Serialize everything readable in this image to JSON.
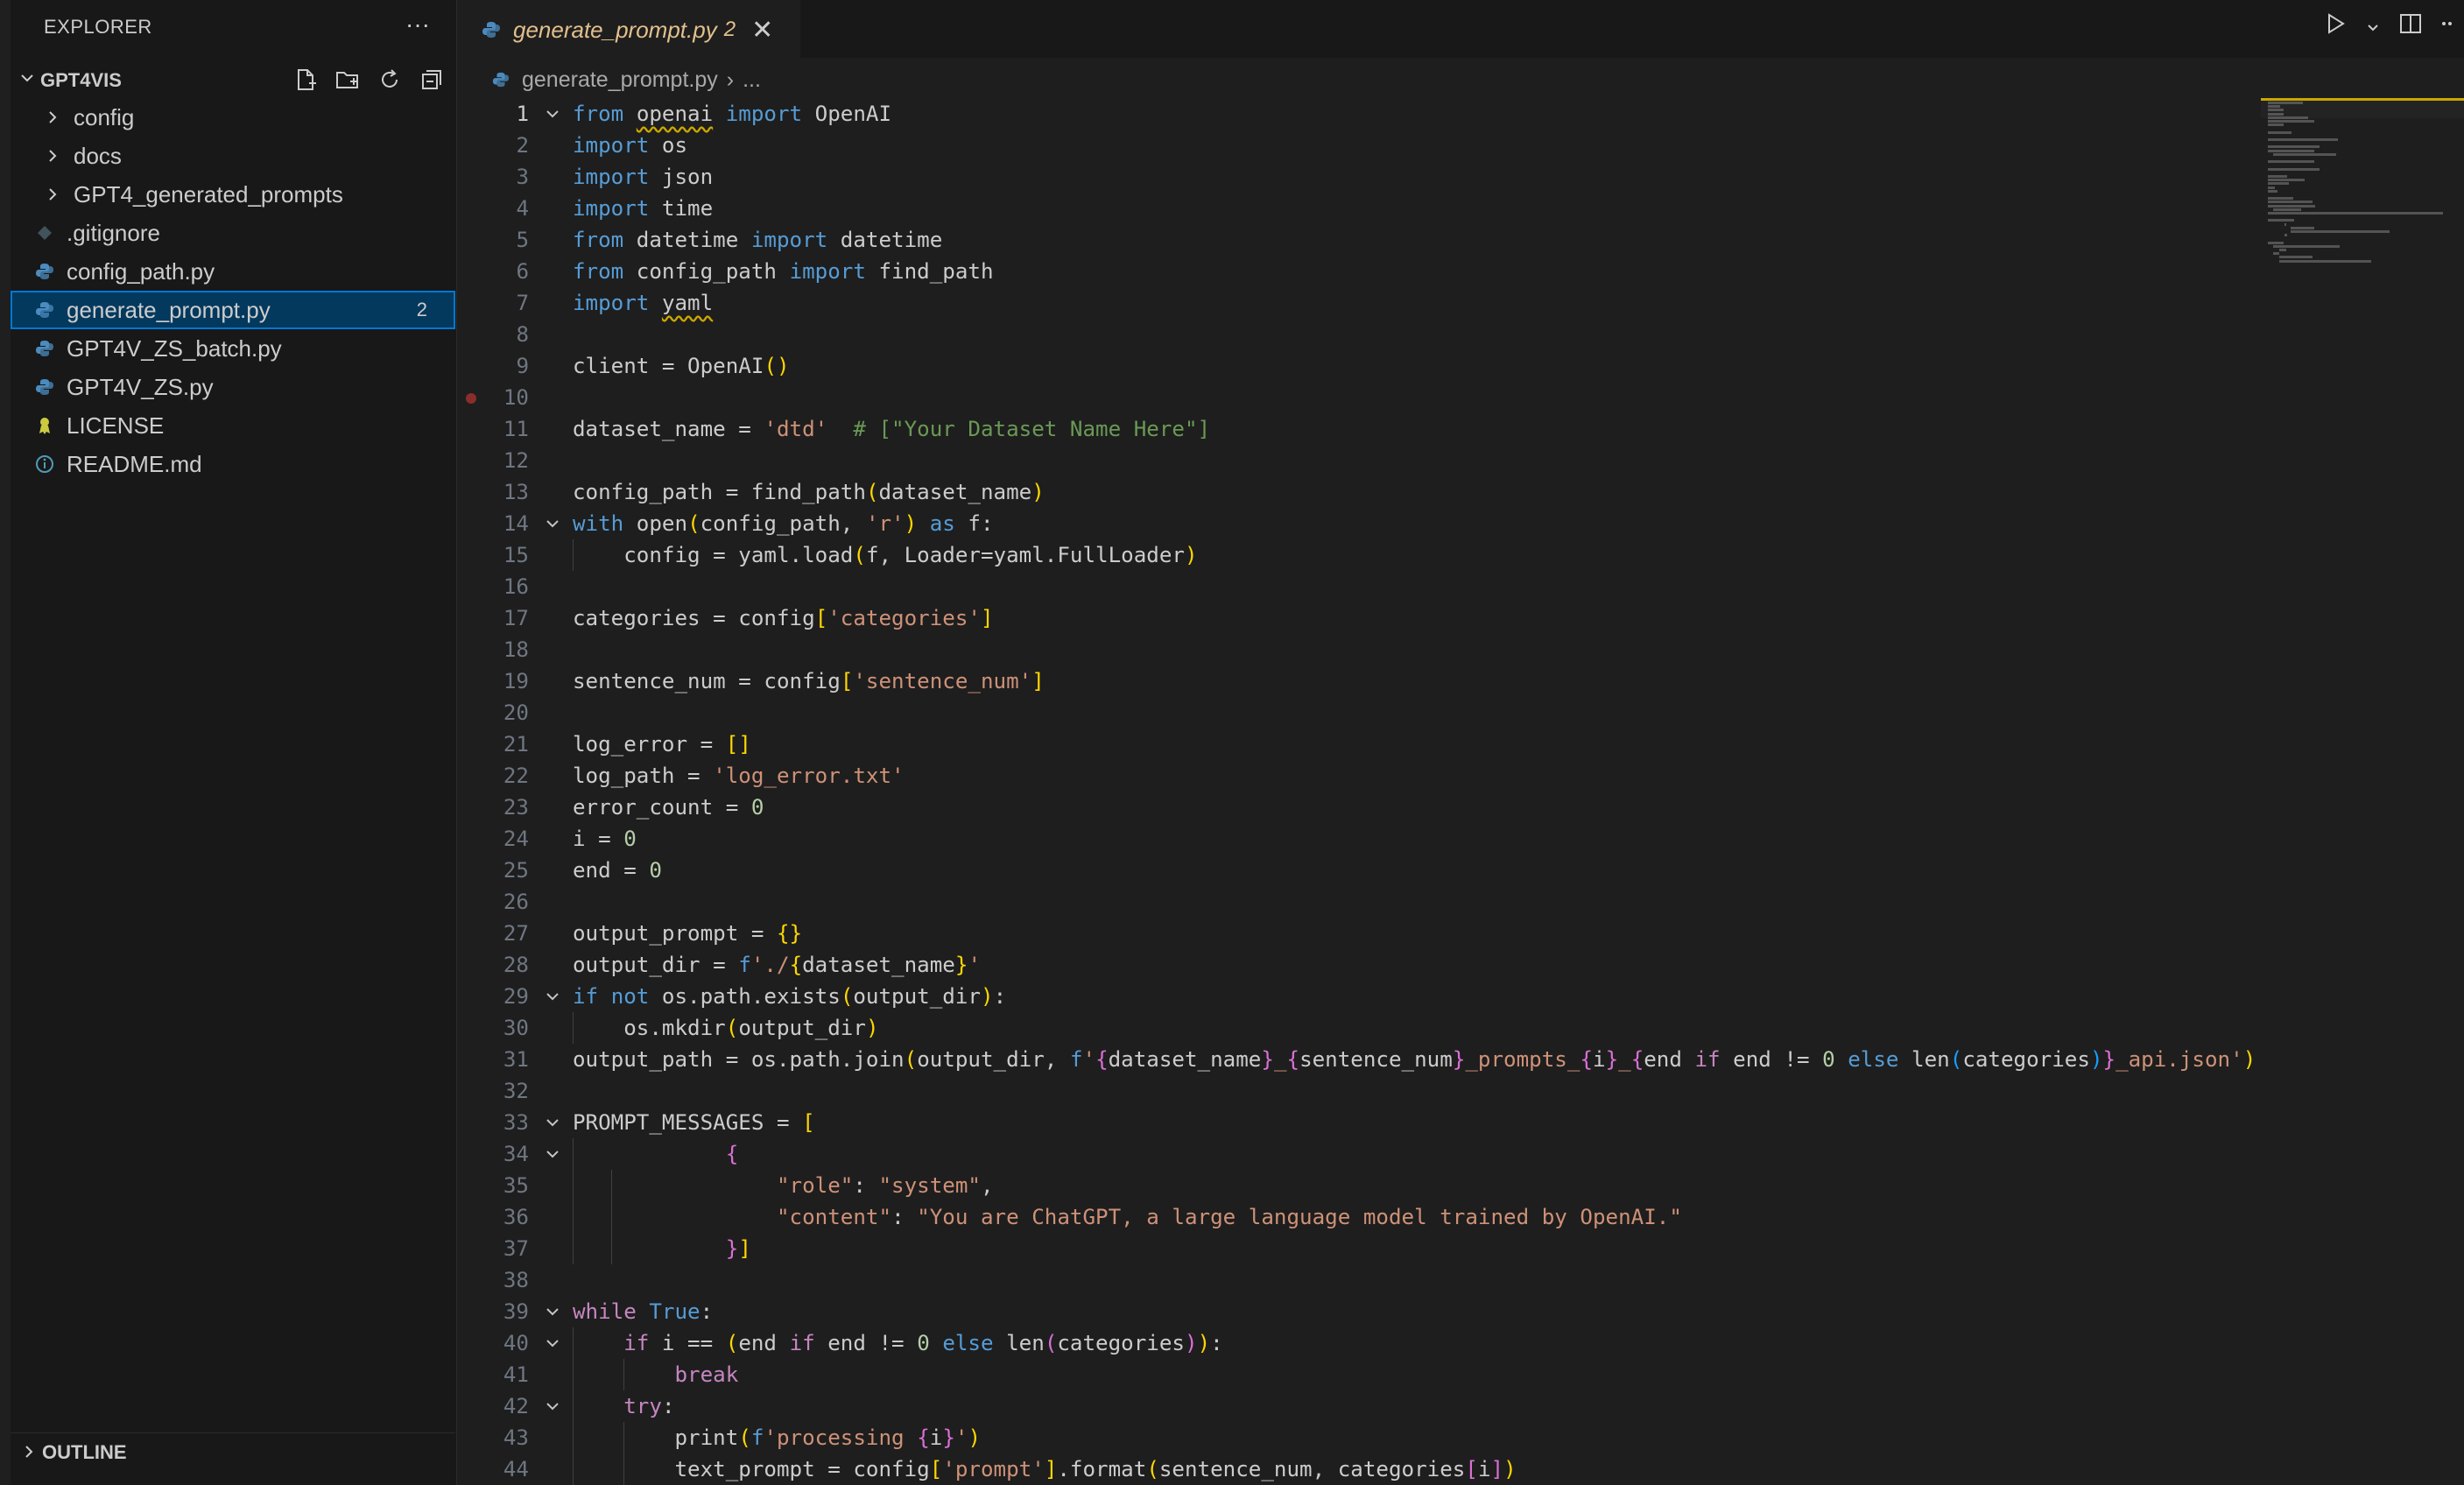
{
  "sidebar": {
    "title": "EXPLORER",
    "more": "···",
    "workspace": "GPT4VIS",
    "items": [
      {
        "label": "config",
        "type": "folder"
      },
      {
        "label": "docs",
        "type": "folder"
      },
      {
        "label": "GPT4_generated_prompts",
        "type": "folder"
      },
      {
        "label": ".gitignore",
        "type": "git"
      },
      {
        "label": "config_path.py",
        "type": "py"
      },
      {
        "label": "generate_prompt.py",
        "type": "py",
        "badge": "2",
        "selected": true
      },
      {
        "label": "GPT4V_ZS_batch.py",
        "type": "py"
      },
      {
        "label": "GPT4V_ZS.py",
        "type": "py"
      },
      {
        "label": "LICENSE",
        "type": "license"
      },
      {
        "label": "README.md",
        "type": "info"
      }
    ],
    "outline": "OUTLINE"
  },
  "tab": {
    "name": "generate_prompt.py",
    "problems": "2",
    "close": "✕"
  },
  "breadcrumb": {
    "file": "generate_prompt.py",
    "sep": "›",
    "rest": "..."
  },
  "editor": {
    "current_line": 1,
    "breakpoint_line": 10,
    "fold_lines": [
      1,
      14,
      29,
      33,
      34,
      39,
      40,
      42
    ]
  },
  "colors": {
    "accent": "#0078d4",
    "selection": "#04395e",
    "modified": "#e2c08d",
    "python": "#4b8bbe",
    "warning": "#cca700"
  },
  "code": [
    [
      [
        "kb",
        "from"
      ],
      [
        "",
        " "
      ],
      [
        "sq",
        "openai"
      ],
      [
        "",
        " "
      ],
      [
        "kb",
        "import"
      ],
      [
        "",
        " OpenAI"
      ]
    ],
    [
      [
        "kb",
        "import"
      ],
      [
        "",
        " os"
      ]
    ],
    [
      [
        "kb",
        "import"
      ],
      [
        "",
        " json"
      ]
    ],
    [
      [
        "kb",
        "import"
      ],
      [
        "",
        " time"
      ]
    ],
    [
      [
        "kb",
        "from"
      ],
      [
        "",
        " datetime "
      ],
      [
        "kb",
        "import"
      ],
      [
        "",
        " datetime"
      ]
    ],
    [
      [
        "kb",
        "from"
      ],
      [
        "",
        " config_path "
      ],
      [
        "kb",
        "import"
      ],
      [
        "",
        " find_path"
      ]
    ],
    [
      [
        "kb",
        "import"
      ],
      [
        "",
        " "
      ],
      [
        "sq",
        "yaml"
      ]
    ],
    [],
    [
      [
        "",
        "client = OpenAI"
      ],
      [
        "p1",
        "()"
      ]
    ],
    [],
    [
      [
        "",
        "dataset_name = "
      ],
      [
        "st",
        "'dtd'"
      ],
      [
        "",
        "  "
      ],
      [
        "cm",
        "# [\"Your Dataset Name Here\"]"
      ]
    ],
    [],
    [
      [
        "",
        "config_path = find_path"
      ],
      [
        "p1",
        "("
      ],
      [
        "",
        "dataset_name"
      ],
      [
        "p1",
        ")"
      ]
    ],
    [
      [
        "kb",
        "with"
      ],
      [
        "",
        " open"
      ],
      [
        "p1",
        "("
      ],
      [
        "",
        "config_path, "
      ],
      [
        "st",
        "'r'"
      ],
      [
        "p1",
        ")"
      ],
      [
        "",
        " "
      ],
      [
        "kb",
        "as"
      ],
      [
        "",
        " f:"
      ]
    ],
    [
      [
        "",
        "    config = yaml.load"
      ],
      [
        "p1",
        "("
      ],
      [
        "",
        "f, Loader=yaml.FullLoader"
      ],
      [
        "p1",
        ")"
      ]
    ],
    [],
    [
      [
        "",
        "categories = config"
      ],
      [
        "p1",
        "["
      ],
      [
        "st",
        "'categories'"
      ],
      [
        "p1",
        "]"
      ]
    ],
    [],
    [
      [
        "",
        "sentence_num = config"
      ],
      [
        "p1",
        "["
      ],
      [
        "st",
        "'sentence_num'"
      ],
      [
        "p1",
        "]"
      ]
    ],
    [],
    [
      [
        "",
        "log_error = "
      ],
      [
        "p1",
        "[]"
      ]
    ],
    [
      [
        "",
        "log_path = "
      ],
      [
        "st",
        "'log_error.txt'"
      ]
    ],
    [
      [
        "",
        "error_count = "
      ],
      [
        "nm",
        "0"
      ]
    ],
    [
      [
        "",
        "i = "
      ],
      [
        "nm",
        "0"
      ]
    ],
    [
      [
        "",
        "end = "
      ],
      [
        "nm",
        "0"
      ]
    ],
    [],
    [
      [
        "",
        "output_prompt = "
      ],
      [
        "p1",
        "{}"
      ]
    ],
    [
      [
        "",
        "output_dir = "
      ],
      [
        "kb",
        "f"
      ],
      [
        "st",
        "'./"
      ],
      [
        "p1",
        "{"
      ],
      [
        "",
        "dataset_name"
      ],
      [
        "p1",
        "}"
      ],
      [
        "st",
        "'"
      ]
    ],
    [
      [
        "kb",
        "if"
      ],
      [
        "",
        " "
      ],
      [
        "kb",
        "not"
      ],
      [
        "",
        " os.path.exists"
      ],
      [
        "p1",
        "("
      ],
      [
        "",
        "output_dir"
      ],
      [
        "p1",
        ")"
      ],
      [
        "",
        ":"
      ]
    ],
    [
      [
        "",
        "    os.mkdir"
      ],
      [
        "p1",
        "("
      ],
      [
        "",
        "output_dir"
      ],
      [
        "p1",
        ")"
      ]
    ],
    [
      [
        "",
        "output_path = os.path.join"
      ],
      [
        "p1",
        "("
      ],
      [
        "",
        "output_dir, "
      ],
      [
        "kb",
        "f"
      ],
      [
        "st",
        "'"
      ],
      [
        "p2",
        "{"
      ],
      [
        "",
        "dataset_name"
      ],
      [
        "p2",
        "}"
      ],
      [
        "st",
        "_"
      ],
      [
        "p2",
        "{"
      ],
      [
        "",
        "sentence_num"
      ],
      [
        "p2",
        "}"
      ],
      [
        "st",
        "_prompts_"
      ],
      [
        "p2",
        "{"
      ],
      [
        "",
        "i"
      ],
      [
        "p2",
        "}"
      ],
      [
        "st",
        "_"
      ],
      [
        "p2",
        "{"
      ],
      [
        "",
        "end "
      ],
      [
        "kw",
        "if"
      ],
      [
        "",
        " end != "
      ],
      [
        "nm",
        "0"
      ],
      [
        "",
        " "
      ],
      [
        "kb",
        "else"
      ],
      [
        "",
        " len"
      ],
      [
        "p3",
        "("
      ],
      [
        "",
        "categories"
      ],
      [
        "p3",
        ")"
      ],
      [
        "p2",
        "}"
      ],
      [
        "st",
        "_api.json'"
      ],
      [
        "p1",
        ")"
      ]
    ],
    [],
    [
      [
        "",
        "PROMPT_MESSAGES = "
      ],
      [
        "p1",
        "["
      ]
    ],
    [
      [
        "",
        "            "
      ],
      [
        "p2",
        "{"
      ]
    ],
    [
      [
        "",
        "                "
      ],
      [
        "st",
        "\"role\""
      ],
      [
        "",
        ": "
      ],
      [
        "st",
        "\"system\""
      ],
      [
        "",
        ","
      ]
    ],
    [
      [
        "",
        "                "
      ],
      [
        "st",
        "\"content\""
      ],
      [
        "",
        ": "
      ],
      [
        "st",
        "\"You are ChatGPT, a large language model trained by OpenAI.\""
      ]
    ],
    [
      [
        "",
        "            "
      ],
      [
        "p2",
        "}"
      ],
      [
        "p1",
        "]"
      ]
    ],
    [],
    [
      [
        "kw",
        "while"
      ],
      [
        "",
        " "
      ],
      [
        "kb",
        "True"
      ],
      [
        "",
        ":"
      ]
    ],
    [
      [
        "",
        "    "
      ],
      [
        "kw",
        "if"
      ],
      [
        "",
        " i == "
      ],
      [
        "p1",
        "("
      ],
      [
        "",
        "end "
      ],
      [
        "kw",
        "if"
      ],
      [
        "",
        " end != "
      ],
      [
        "nm",
        "0"
      ],
      [
        "",
        " "
      ],
      [
        "kb",
        "else"
      ],
      [
        "",
        " len"
      ],
      [
        "p2",
        "("
      ],
      [
        "",
        "categories"
      ],
      [
        "p2",
        ")"
      ],
      [
        "p1",
        ")"
      ],
      [
        "",
        ":"
      ]
    ],
    [
      [
        "",
        "        "
      ],
      [
        "kw",
        "break"
      ]
    ],
    [
      [
        "",
        "    "
      ],
      [
        "kw",
        "try"
      ],
      [
        "",
        ":"
      ]
    ],
    [
      [
        "",
        "        print"
      ],
      [
        "p1",
        "("
      ],
      [
        "kb",
        "f"
      ],
      [
        "st",
        "'processing "
      ],
      [
        "p2",
        "{"
      ],
      [
        "",
        "i"
      ],
      [
        "p2",
        "}"
      ],
      [
        "st",
        "'"
      ],
      [
        "p1",
        ")"
      ]
    ],
    [
      [
        "",
        "        text_prompt = config"
      ],
      [
        "p1",
        "["
      ],
      [
        "st",
        "'prompt'"
      ],
      [
        "p1",
        "]"
      ],
      [
        "",
        ".format"
      ],
      [
        "p1",
        "("
      ],
      [
        "",
        "sentence_num, categories"
      ],
      [
        "p2",
        "["
      ],
      [
        "",
        "i"
      ],
      [
        "p2",
        "]"
      ],
      [
        "p1",
        ")"
      ]
    ]
  ]
}
